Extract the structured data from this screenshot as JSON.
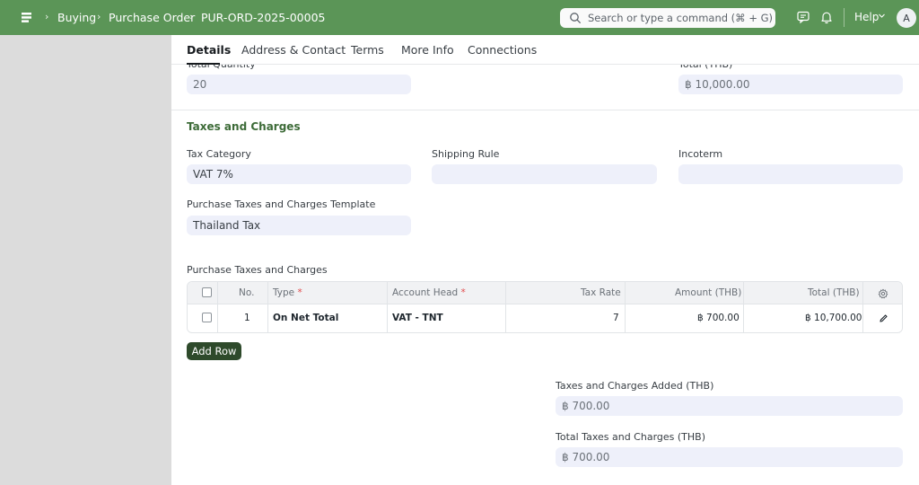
{
  "navbar": {
    "breadcrumbs": [
      "Buying",
      "Purchase Order",
      "PUR-ORD-2025-00005"
    ],
    "search_placeholder": "Search or type a command (⌘ + G)",
    "help_label": "Help",
    "avatar_initial": "A",
    "accent_color": "#5b9557"
  },
  "tabs": [
    "Details",
    "Address & Contact",
    "Terms",
    "More Info",
    "Connections"
  ],
  "totals_top": {
    "total_quantity_label": "Total Quantity",
    "total_quantity_value": "20",
    "total_label": "Total (THB)",
    "total_value": "฿ 10,000.00"
  },
  "taxes_section": {
    "title": "Taxes and Charges",
    "tax_category_label": "Tax Category",
    "tax_category_value": "VAT 7%",
    "shipping_rule_label": "Shipping Rule",
    "shipping_rule_value": "",
    "incoterm_label": "Incoterm",
    "incoterm_value": "",
    "template_label": "Purchase Taxes and Charges Template",
    "template_value": "Thailand Tax",
    "table_label": "Purchase Taxes and Charges",
    "table": {
      "headers": [
        "No.",
        "Type",
        "Account Head",
        "Tax Rate",
        "Amount (THB)",
        "Total (THB)"
      ],
      "required_mark": "*",
      "rows": [
        {
          "no": "1",
          "type": "On Net Total",
          "account_head": "VAT - TNT",
          "tax_rate": "7",
          "amount": "฿ 700.00",
          "total": "฿ 10,700.00"
        }
      ]
    },
    "add_row_label": "Add Row",
    "taxes_added_label": "Taxes and Charges Added (THB)",
    "taxes_added_value": "฿ 700.00",
    "total_taxes_label": "Total Taxes and Charges (THB)",
    "total_taxes_value": "฿ 700.00"
  }
}
